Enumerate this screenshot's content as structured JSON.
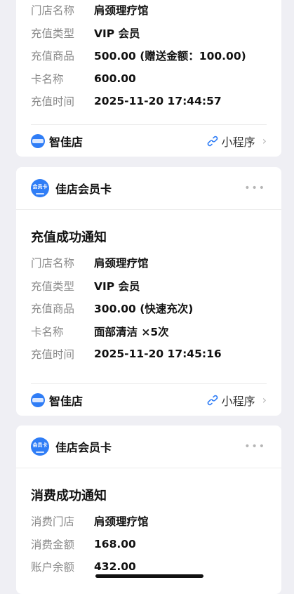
{
  "card1": {
    "rows": [
      {
        "k": "门店名称",
        "v": "肩颈理疗馆"
      },
      {
        "k": "充值类型",
        "v": "VIP 会员"
      },
      {
        "k": "充值商品",
        "v": "500.00 (赠送金额：100.00)"
      },
      {
        "k": "卡名称",
        "v": "600.00"
      },
      {
        "k": "充值时间",
        "v": "2025-11-20 17:44:57"
      }
    ],
    "footer": {
      "brand": "智佳店",
      "mini": "小程序"
    }
  },
  "card2": {
    "account": "佳店会员卡",
    "account_icon_text": "会员卡",
    "title": "充值成功通知",
    "rows": [
      {
        "k": "门店名称",
        "v": "肩颈理疗馆"
      },
      {
        "k": "充值类型",
        "v": "VIP 会员"
      },
      {
        "k": "充值商品",
        "v": "300.00 (快速充次)"
      },
      {
        "k": "卡名称",
        "v": "面部清洁 ×5次"
      },
      {
        "k": "充值时间",
        "v": "2025-11-20 17:45:16"
      }
    ],
    "footer": {
      "brand": "智佳店",
      "mini": "小程序"
    }
  },
  "card3": {
    "account": "佳店会员卡",
    "account_icon_text": "会员卡",
    "title": "消费成功通知",
    "rows": [
      {
        "k": "消费门店",
        "v": "肩颈理疗馆"
      },
      {
        "k": "消费金额",
        "v": "168.00"
      },
      {
        "k": "账户余额",
        "v": "432.00"
      }
    ]
  },
  "more_icon": "more-dots-icon",
  "mini_icon": "link-icon",
  "colors": {
    "accent": "#2f7df6",
    "background": "#efeff4"
  }
}
